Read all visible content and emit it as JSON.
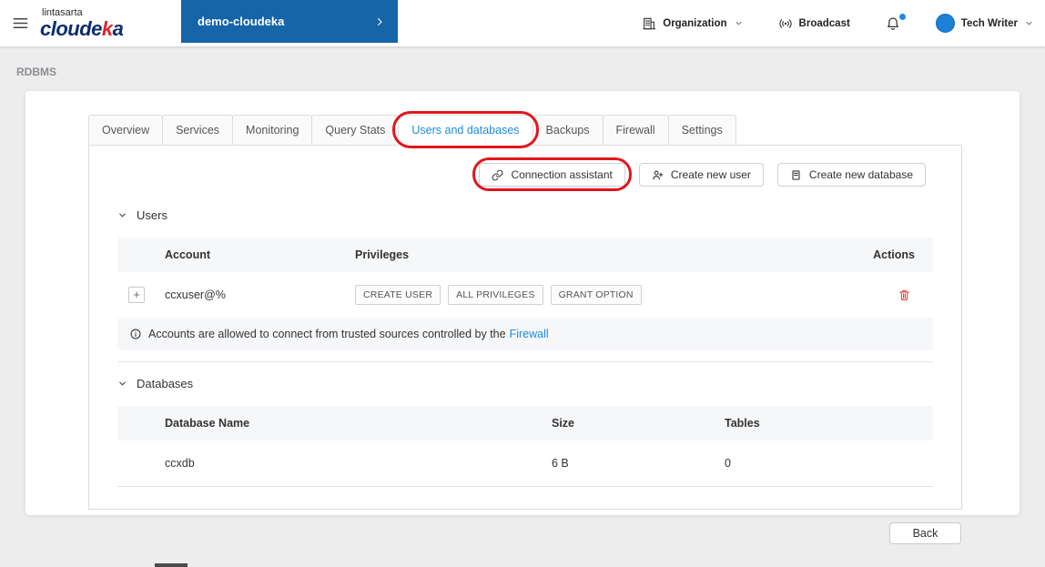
{
  "topbar": {
    "brand": {
      "line1": "lintasarta",
      "pre": "cloude",
      "accent": "k",
      "post": "a"
    },
    "project": "demo-cloudeka",
    "organization_label": "Organization",
    "broadcast_label": "Broadcast",
    "user_name": "Tech Writer"
  },
  "breadcrumb": "RDBMS",
  "tabs": [
    {
      "label": "Overview"
    },
    {
      "label": "Services"
    },
    {
      "label": "Monitoring"
    },
    {
      "label": "Query Stats"
    },
    {
      "label": "Users and databases",
      "active": true,
      "annotated": true
    },
    {
      "label": "Backups"
    },
    {
      "label": "Firewall"
    },
    {
      "label": "Settings"
    }
  ],
  "toolbar": {
    "connection_assistant": "Connection assistant",
    "create_new_user": "Create new user",
    "create_new_database": "Create new database"
  },
  "users": {
    "section_title": "Users",
    "columns": {
      "account": "Account",
      "privileges": "Privileges",
      "actions": "Actions"
    },
    "expand_label": "+",
    "rows": [
      {
        "account": "ccxuser@%",
        "privileges": [
          "CREATE USER",
          "ALL PRIVILEGES",
          "GRANT OPTION"
        ]
      }
    ],
    "note_text": "Accounts are allowed to connect from trusted sources controlled by the",
    "note_link": "Firewall"
  },
  "databases": {
    "section_title": "Databases",
    "columns": {
      "name": "Database Name",
      "size": "Size",
      "tables": "Tables"
    },
    "rows": [
      {
        "name": "ccxdb",
        "size": "6 B",
        "tables": "0"
      }
    ]
  },
  "footer": {
    "back": "Back"
  },
  "colors": {
    "primary_blue": "#1565a8",
    "active_tab_blue": "#1f8ae0",
    "annotation_red": "#e0171c",
    "brand_navy": "#0b2e6f",
    "brand_accent_red": "#d9262c",
    "danger_red": "#e0413d",
    "page_background": "#ededee"
  }
}
